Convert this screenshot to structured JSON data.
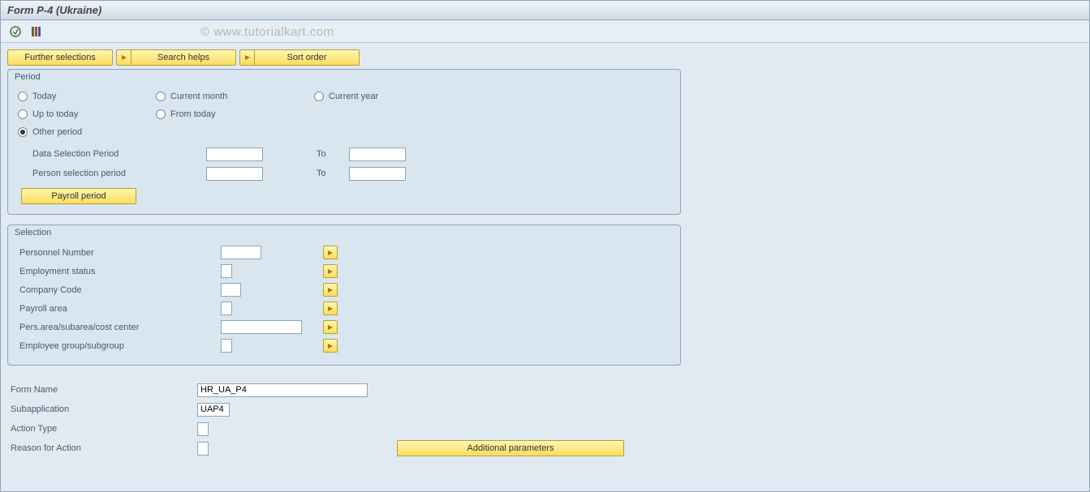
{
  "title": "Form P-4 (Ukraine)",
  "watermark": "© www.tutorialkart.com",
  "toolbar": {
    "further_selections": "Further selections",
    "search_helps": "Search helps",
    "sort_order": "Sort order"
  },
  "period": {
    "groupTitle": "Period",
    "options": {
      "today": "Today",
      "current_month": "Current month",
      "current_year": "Current year",
      "up_to_today": "Up to today",
      "from_today": "From today",
      "other_period": "Other period"
    },
    "selected": "other_period",
    "data_selection_period_label": "Data Selection Period",
    "person_selection_period_label": "Person selection period",
    "to_label": "To",
    "data_selection_from": "",
    "data_selection_to": "",
    "person_selection_from": "",
    "person_selection_to": "",
    "payroll_period_btn": "Payroll period"
  },
  "selection": {
    "groupTitle": "Selection",
    "rows": {
      "personnel_number": {
        "label": "Personnel Number",
        "value": ""
      },
      "employment_status": {
        "label": "Employment status",
        "value": ""
      },
      "company_code": {
        "label": "Company Code",
        "value": ""
      },
      "payroll_area": {
        "label": "Payroll area",
        "value": ""
      },
      "pers_area": {
        "label": "Pers.area/subarea/cost center",
        "value": ""
      },
      "employee_group": {
        "label": "Employee group/subgroup",
        "value": ""
      }
    }
  },
  "bottom": {
    "form_name_label": "Form Name",
    "form_name_value": "HR_UA_P4",
    "subapplication_label": "Subapplication",
    "subapplication_value": "UAP4",
    "action_type_label": "Action Type",
    "action_type_value": "",
    "reason_for_action_label": "Reason for Action",
    "reason_for_action_value": "",
    "additional_parameters_btn": "Additional parameters"
  }
}
